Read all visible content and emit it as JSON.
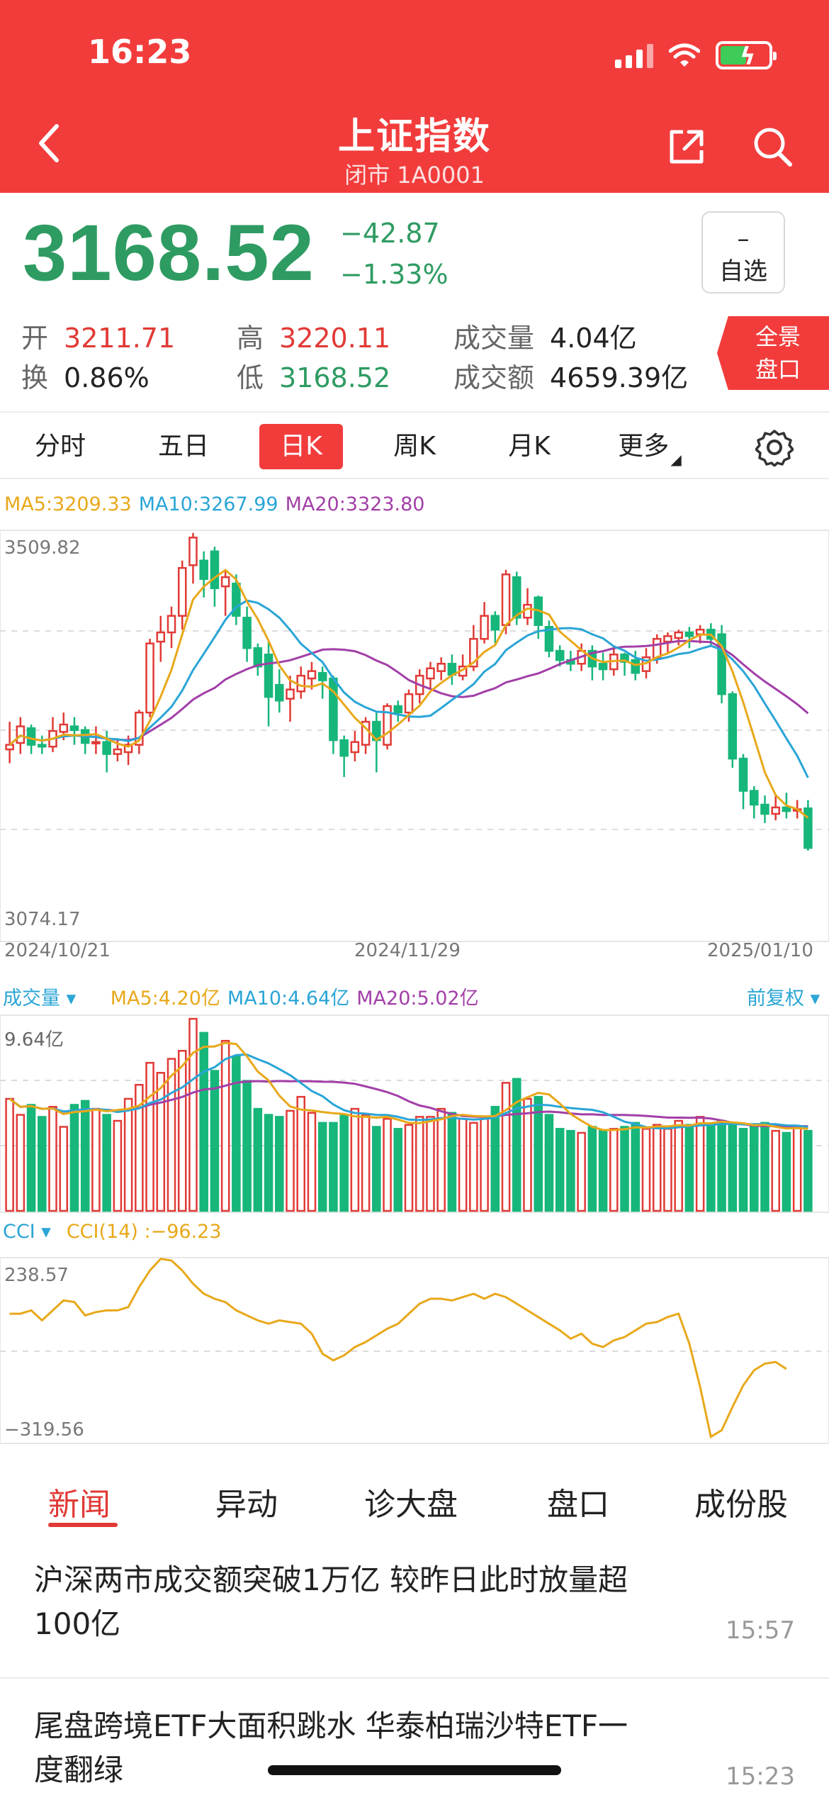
{
  "status_bar": {
    "time": "16:23"
  },
  "header": {
    "title": "上证指数",
    "subtitle": "闭市 1A0001"
  },
  "quote": {
    "price": "3168.52",
    "change": "−42.87",
    "change_pct": "−1.33%",
    "watch_button": {
      "symbol": "–",
      "label": "自选"
    }
  },
  "stats": {
    "open": {
      "label": "开",
      "value": "3211.71"
    },
    "high": {
      "label": "高",
      "value": "3220.11"
    },
    "volume": {
      "label": "成交量",
      "value": "4.04亿"
    },
    "turnover": {
      "label": "换",
      "value": "0.86%"
    },
    "low": {
      "label": "低",
      "value": "3168.52"
    },
    "amount": {
      "label": "成交额",
      "value": "4659.39亿"
    }
  },
  "full_panel_button": {
    "line1": "全景",
    "line2": "盘口"
  },
  "period_tabs": [
    "分时",
    "五日",
    "日K",
    "周K",
    "月K",
    "更多"
  ],
  "active_period": "日K",
  "ma_legend": {
    "ma5": "MA5:3209.33",
    "ma10": "MA10:3267.99",
    "ma20": "MA20:3323.80"
  },
  "price_axis": {
    "high": "3509.82",
    "low": "3074.17"
  },
  "date_axis": [
    "2024/10/21",
    "2024/11/29",
    "2025/01/10"
  ],
  "volume_legend": {
    "selector": "成交量 ▾",
    "ma5": "MA5:4.20亿",
    "ma10": "MA10:4.64亿",
    "ma20": "MA20:5.02亿",
    "max": "9.64亿"
  },
  "adjust_select": "前复权 ▾",
  "cci_legend": {
    "selector": "CCI ▾",
    "value": "CCI(14) :−96.23",
    "max": "238.57",
    "min": "−319.56"
  },
  "colors": {
    "up": "#e13a36",
    "down": "#17b67a",
    "ma5": "#e8a81a",
    "ma10": "#2aa5d6",
    "ma20": "#a23fa8",
    "brand": "#f23c3c"
  },
  "news_tabs": [
    "新闻",
    "异动",
    "诊大盘",
    "盘口",
    "成份股"
  ],
  "active_news_tab": "新闻",
  "news": [
    {
      "title": "沪深两市成交额突破1万亿 较昨日此时放量超100亿",
      "time": "15:57"
    },
    {
      "title": "尾盘跨境ETF大面积跳水 华泰柏瑞沙特ETF一度翻绿",
      "time": "15:23"
    }
  ],
  "chart_data": [
    {
      "type": "candlestick",
      "title": "日K",
      "ylim": [
        3074.17,
        3509.82
      ],
      "x_ticks": [
        "2024/10/21",
        "2024/11/29",
        "2025/01/10"
      ],
      "candles": [
        [
          3275,
          3280,
          3260,
          3305
        ],
        [
          3282,
          3300,
          3270,
          3310
        ],
        [
          3298,
          3280,
          3270,
          3302
        ],
        [
          3280,
          3278,
          3270,
          3290
        ],
        [
          3278,
          3295,
          3272,
          3310
        ],
        [
          3294,
          3302,
          3285,
          3315
        ],
        [
          3300,
          3296,
          3280,
          3310
        ],
        [
          3296,
          3282,
          3270,
          3300
        ],
        [
          3282,
          3283,
          3270,
          3300
        ],
        [
          3283,
          3270,
          3250,
          3295
        ],
        [
          3270,
          3275,
          3262,
          3285
        ],
        [
          3272,
          3280,
          3258,
          3290
        ],
        [
          3280,
          3315,
          3270,
          3318
        ],
        [
          3315,
          3390,
          3310,
          3395
        ],
        [
          3392,
          3402,
          3370,
          3420
        ],
        [
          3402,
          3420,
          3385,
          3430
        ],
        [
          3420,
          3472,
          3405,
          3480
        ],
        [
          3475,
          3505,
          3455,
          3510
        ],
        [
          3480,
          3460,
          3440,
          3490
        ],
        [
          3490,
          3450,
          3430,
          3495
        ],
        [
          3452,
          3462,
          3420,
          3470
        ],
        [
          3455,
          3420,
          3410,
          3465
        ],
        [
          3418,
          3385,
          3370,
          3430
        ],
        [
          3385,
          3365,
          3355,
          3390
        ],
        [
          3378,
          3332,
          3300,
          3392
        ],
        [
          3345,
          3328,
          3315,
          3362
        ],
        [
          3330,
          3340,
          3305,
          3355
        ],
        [
          3338,
          3355,
          3330,
          3365
        ],
        [
          3352,
          3360,
          3340,
          3370
        ],
        [
          3358,
          3350,
          3330,
          3365
        ],
        [
          3352,
          3285,
          3270,
          3355
        ],
        [
          3285,
          3268,
          3245,
          3290
        ],
        [
          3272,
          3283,
          3262,
          3295
        ],
        [
          3280,
          3305,
          3270,
          3310
        ],
        [
          3305,
          3285,
          3250,
          3315
        ],
        [
          3280,
          3322,
          3275,
          3325
        ],
        [
          3322,
          3315,
          3305,
          3328
        ],
        [
          3315,
          3335,
          3305,
          3340
        ],
        [
          3335,
          3355,
          3325,
          3362
        ],
        [
          3352,
          3363,
          3340,
          3370
        ],
        [
          3360,
          3368,
          3350,
          3375
        ],
        [
          3368,
          3356,
          3345,
          3378
        ],
        [
          3355,
          3365,
          3350,
          3378
        ],
        [
          3365,
          3395,
          3360,
          3410
        ],
        [
          3395,
          3420,
          3390,
          3435
        ],
        [
          3420,
          3405,
          3390,
          3425
        ],
        [
          3410,
          3465,
          3400,
          3470
        ],
        [
          3462,
          3418,
          3410,
          3468
        ],
        [
          3418,
          3432,
          3410,
          3450
        ],
        [
          3440,
          3410,
          3395,
          3442
        ],
        [
          3408,
          3382,
          3375,
          3415
        ],
        [
          3382,
          3372,
          3365,
          3388
        ],
        [
          3372,
          3368,
          3360,
          3382
        ],
        [
          3368,
          3382,
          3360,
          3390
        ],
        [
          3382,
          3365,
          3350,
          3388
        ],
        [
          3368,
          3362,
          3350,
          3380
        ],
        [
          3362,
          3378,
          3355,
          3385
        ],
        [
          3378,
          3370,
          3355,
          3380
        ],
        [
          3372,
          3358,
          3350,
          3382
        ],
        [
          3360,
          3375,
          3352,
          3385
        ],
        [
          3374,
          3395,
          3368,
          3400
        ],
        [
          3392,
          3398,
          3380,
          3402
        ],
        [
          3396,
          3402,
          3388,
          3405
        ],
        [
          3402,
          3398,
          3385,
          3408
        ],
        [
          3400,
          3405,
          3390,
          3410
        ],
        [
          3405,
          3395,
          3388,
          3412
        ],
        [
          3400,
          3335,
          3325,
          3410
        ],
        [
          3335,
          3265,
          3255,
          3338
        ],
        [
          3265,
          3230,
          3210,
          3270
        ],
        [
          3230,
          3215,
          3200,
          3235
        ],
        [
          3215,
          3205,
          3195,
          3225
        ],
        [
          3205,
          3212,
          3198,
          3225
        ],
        [
          3212,
          3208,
          3200,
          3228
        ],
        [
          3210,
          3210,
          3200,
          3220
        ],
        [
          3211,
          3168,
          3165,
          3220
        ]
      ]
    },
    {
      "type": "bar",
      "title": "成交量",
      "ylim": [
        0,
        9.64
      ],
      "values": [
        5.6,
        4.8,
        5.3,
        4.7,
        5.2,
        4.2,
        5.3,
        5.5,
        5.1,
        4.8,
        4.5,
        5.6,
        6.3,
        7.4,
        6.9,
        7.6,
        8.0,
        9.6,
        8.9,
        7.0,
        8.5,
        7.7,
        6.5,
        5.1,
        4.8,
        4.7,
        5.0,
        5.7,
        4.9,
        4.4,
        4.4,
        4.8,
        5.1,
        4.8,
        4.2,
        4.6,
        4.1,
        4.3,
        4.7,
        4.7,
        5.1,
        4.9,
        4.6,
        4.4,
        4.6,
        5.2,
        6.4,
        6.6,
        5.6,
        5.7,
        4.8,
        4.1,
        4.0,
        3.9,
        4.2,
        4.0,
        4.1,
        4.2,
        4.4,
        4.1,
        4.3,
        4.1,
        4.5,
        4.3,
        4.7,
        4.3,
        4.5,
        4.3,
        4.1,
        4.2,
        4.4,
        4.0,
        3.9,
        4.2,
        4.0
      ],
      "series": [
        {
          "name": "MA5",
          "value": "4.20亿"
        },
        {
          "name": "MA10",
          "value": "4.64亿"
        },
        {
          "name": "MA20",
          "value": "5.02亿"
        }
      ]
    },
    {
      "type": "line",
      "title": "CCI(14)",
      "ylim": [
        -319.56,
        238.57
      ],
      "values": [
        70,
        70,
        80,
        50,
        80,
        110,
        105,
        65,
        75,
        80,
        80,
        90,
        150,
        200,
        235,
        230,
        200,
        160,
        130,
        115,
        105,
        80,
        65,
        50,
        40,
        50,
        45,
        40,
        10,
        -50,
        -70,
        -55,
        -30,
        -15,
        5,
        25,
        40,
        70,
        100,
        115,
        115,
        110,
        120,
        130,
        115,
        130,
        120,
        100,
        80,
        60,
        40,
        20,
        -5,
        10,
        -20,
        -30,
        -10,
        0,
        20,
        40,
        45,
        60,
        70,
        -20,
        -150,
        -300,
        -280,
        -210,
        -145,
        -100,
        -80,
        -75,
        -96
      ]
    }
  ]
}
